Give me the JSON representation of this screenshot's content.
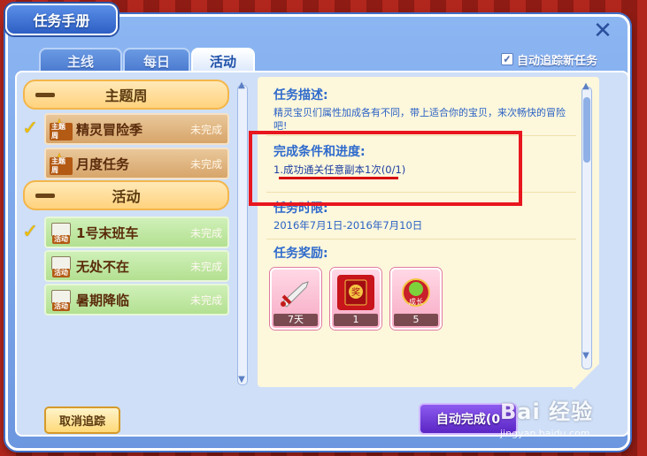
{
  "window": {
    "title": "任务手册",
    "close_icon": "close-icon"
  },
  "auto_track": {
    "label": "自动追踪新任务",
    "checked": true
  },
  "tabs": [
    {
      "label": "主线",
      "active": false
    },
    {
      "label": "每日",
      "active": false
    },
    {
      "label": "活动",
      "active": true
    }
  ],
  "sections": [
    {
      "header": "主题周",
      "items": [
        {
          "badge": "主题周",
          "name": "精灵冒险季",
          "status": "未完成",
          "tracked": true
        },
        {
          "badge": "主题周",
          "name": "月度任务",
          "status": "未完成",
          "tracked": false
        }
      ]
    },
    {
      "header": "活动",
      "items": [
        {
          "badge": "活动",
          "name": "1号末班车",
          "status": "未完成",
          "tracked": true
        },
        {
          "badge": "活动",
          "name": "无处不在",
          "status": "未完成",
          "tracked": false
        },
        {
          "badge": "活动",
          "name": "暑期降临",
          "status": "未完成",
          "tracked": false
        }
      ]
    }
  ],
  "detail": {
    "description_title": "任务描述:",
    "description_text": "精灵宝贝们属性加成各有不同，带上适合你的宝贝，来次畅快的冒险吧!",
    "conditions_title": "完成条件和进度:",
    "condition_prefix": "1.",
    "condition_text": "成功通关任意副本1次",
    "condition_progress": "(0/1)",
    "time_title": "任务时限:",
    "time_text": "2016年7月1日-2016年7月10日",
    "rewards_title": "任务奖励:",
    "rewards": [
      {
        "icon": "sword-icon",
        "count": "7天"
      },
      {
        "icon": "red-envelope-icon",
        "count": "1"
      },
      {
        "icon": "growth-fruit-icon",
        "count": "5"
      }
    ]
  },
  "buttons": {
    "cancel_track": "取消追踪",
    "auto_complete": "自动完成(0"
  },
  "watermark": {
    "logo": "Bai 经验",
    "url": "jingyan.baidu.com"
  },
  "colors": {
    "highlight": "#e8161e",
    "accent": "#2e6acc"
  }
}
